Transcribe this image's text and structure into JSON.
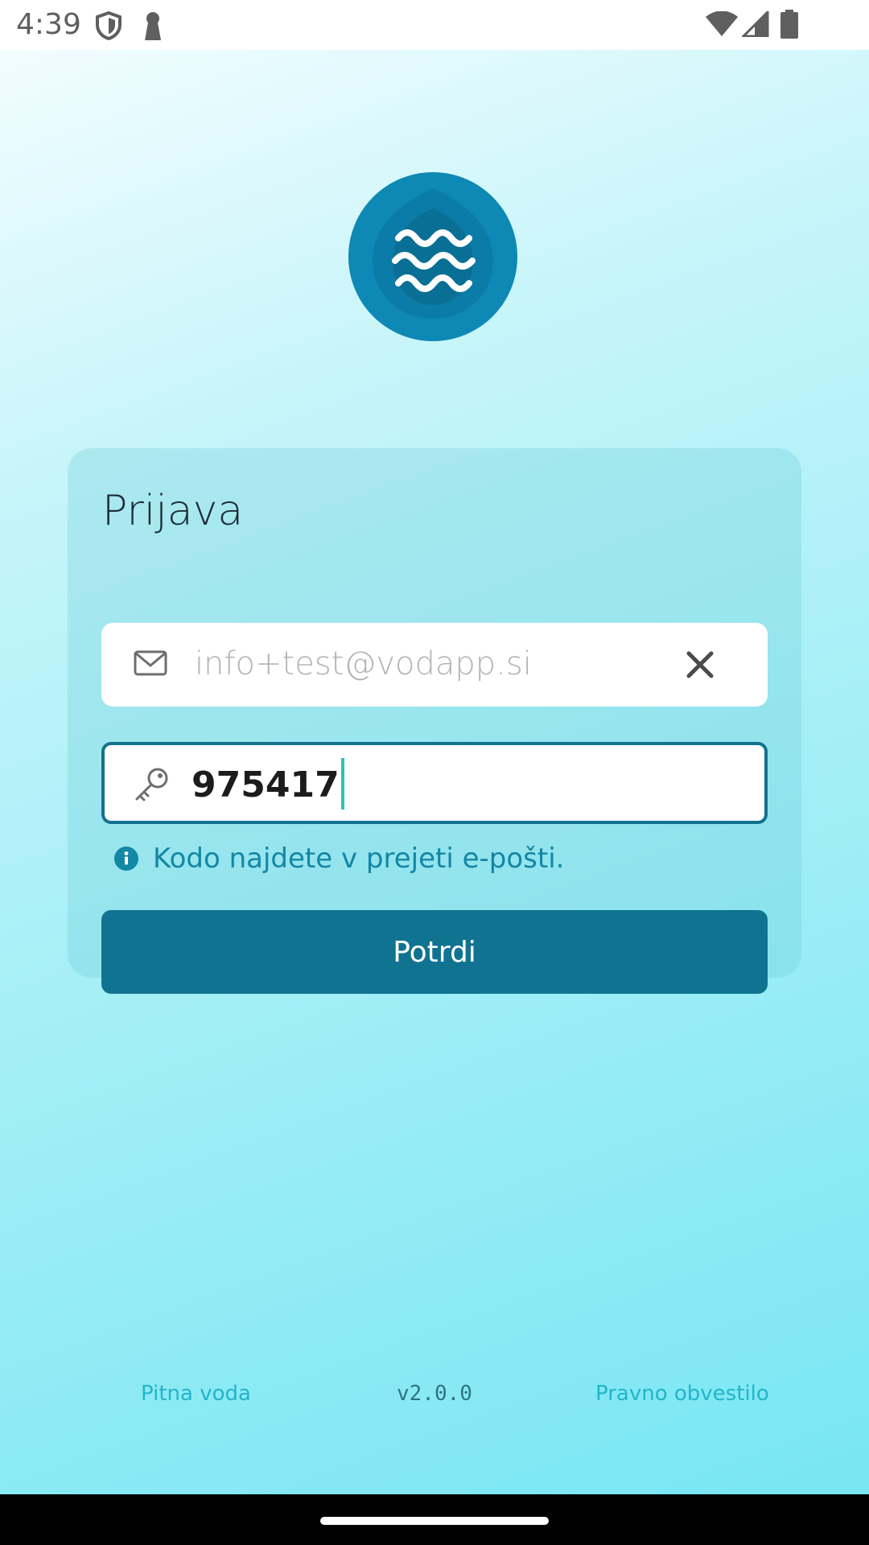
{
  "status_bar": {
    "time": "4:39",
    "icons": [
      "shield-icon",
      "keyhole-icon",
      "wifi-icon",
      "signal-icon",
      "battery-icon"
    ]
  },
  "logo": {
    "icon": "water-waves-icon",
    "colors": {
      "outer": "#0e88b5",
      "inner": "#0a6f95",
      "waves": "#ffffff"
    }
  },
  "login": {
    "title": "Prijava",
    "email": {
      "icon": "mail-icon",
      "value": "info+test@vodapp.si",
      "clear_icon": "close-icon"
    },
    "code": {
      "icon": "key-icon",
      "value": "975417"
    },
    "helper": {
      "icon": "info-icon",
      "text": "Kodo najdete v prejeti e-pošti."
    },
    "submit_label": "Potrdi"
  },
  "footer": {
    "left_link": "Pitna voda",
    "version": "v2.0.0",
    "right_link": "Pravno obvestilo"
  },
  "colors": {
    "accent": "#107391",
    "helper": "#1387a6",
    "footer_link": "#22b5cb",
    "cursor": "#27c4bf"
  }
}
